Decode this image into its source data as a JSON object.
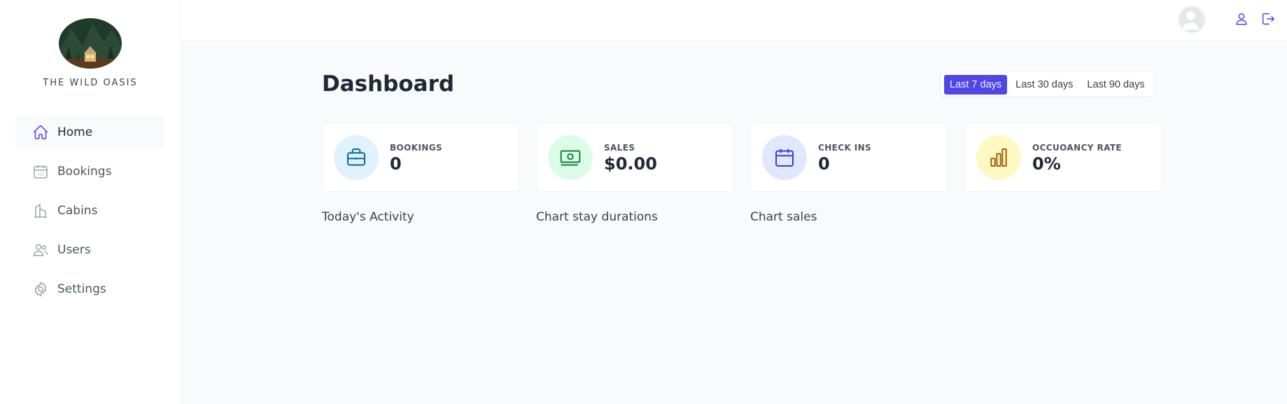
{
  "brand": {
    "name": "THE WILD OASIS"
  },
  "sidebar": {
    "items": [
      {
        "label": "Home",
        "icon": "home-icon",
        "active": true
      },
      {
        "label": "Bookings",
        "icon": "calendar-icon",
        "active": false
      },
      {
        "label": "Cabins",
        "icon": "building-icon",
        "active": false
      },
      {
        "label": "Users",
        "icon": "users-icon",
        "active": false
      },
      {
        "label": "Settings",
        "icon": "gear-icon",
        "active": false
      }
    ]
  },
  "header": {
    "icons": [
      "avatar",
      "user-icon",
      "logout-icon"
    ]
  },
  "main": {
    "title": "Dashboard",
    "filter": {
      "options": [
        "Last 7 days",
        "Last 30 days",
        "Last 90 days"
      ],
      "selected": "Last 7 days"
    },
    "stats": [
      {
        "label": "BOOKINGS",
        "value": "0",
        "icon": "briefcase-icon",
        "color": "#e0f2fe",
        "icon_color": "#0369a1"
      },
      {
        "label": "SALES",
        "value": "$0.00",
        "icon": "banknotes-icon",
        "color": "#dcfce7",
        "icon_color": "#15803d"
      },
      {
        "label": "CHECK INS",
        "value": "0",
        "icon": "calendar-days-icon",
        "color": "#e0e7ff",
        "icon_color": "#4338ca"
      },
      {
        "label": "OCCUOANCY RATE",
        "value": "0%",
        "icon": "chart-bar-icon",
        "color": "#fef9c3",
        "icon_color": "#a16207"
      }
    ],
    "sections": [
      "Today's Activity",
      "Chart stay durations",
      "Chart sales"
    ]
  },
  "colors": {
    "accent": "#4f46e5",
    "background": "#f9fafb"
  }
}
